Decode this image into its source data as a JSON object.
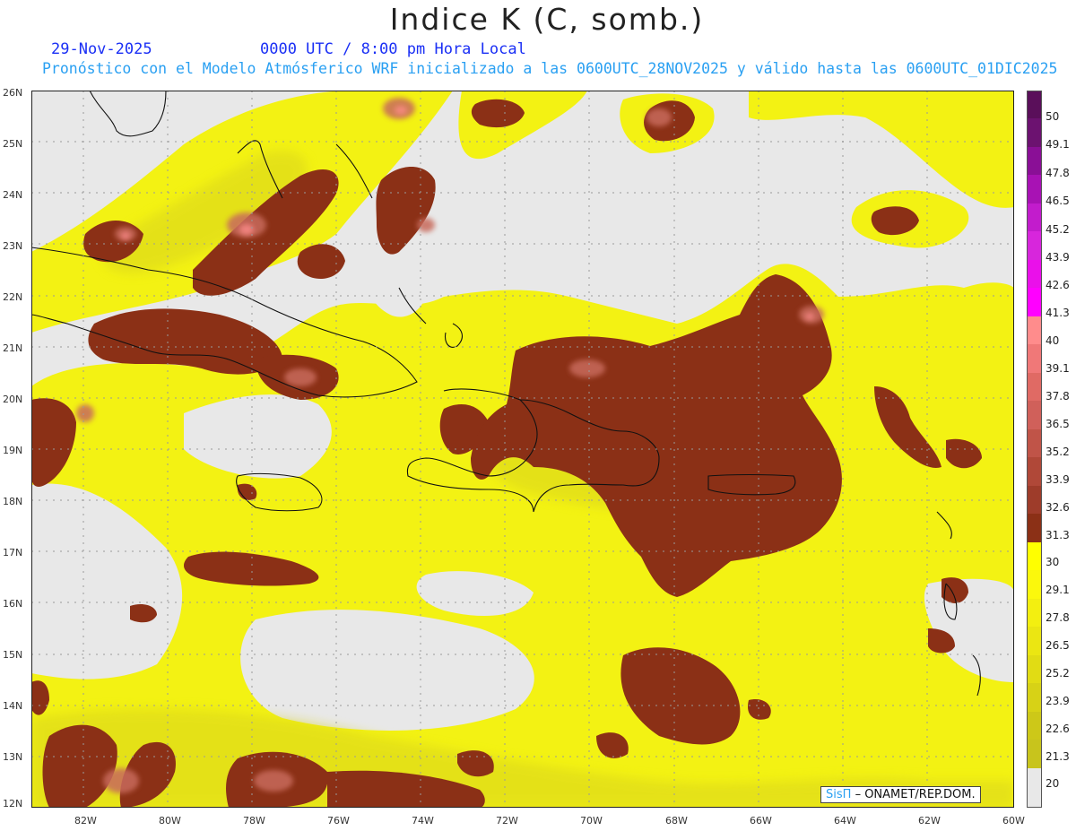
{
  "header": {
    "title": "Indice K (C, somb.)",
    "date": "29-Nov-2025",
    "time": "0000 UTC / 8:00 pm Hora Local",
    "subtitle": "Pronóstico con el Modelo Atmósferico WRF inicializado a las 0600UTC_28NOV2025 y válido hasta las  0600UTC_01DIC2025"
  },
  "axes": {
    "lat_labels": [
      "26N",
      "25N",
      "24N",
      "23N",
      "22N",
      "21N",
      "20N",
      "19N",
      "18N",
      "17N",
      "16N",
      "15N",
      "14N",
      "13N",
      "12N"
    ],
    "lon_labels": [
      "82W",
      "80W",
      "78W",
      "76W",
      "74W",
      "72W",
      "70W",
      "68W",
      "66W",
      "64W",
      "62W",
      "60W"
    ]
  },
  "colorbar": {
    "labels": [
      "50",
      "49.1",
      "47.8",
      "46.5",
      "45.2",
      "43.9",
      "42.6",
      "41.3",
      "40",
      "39.1",
      "37.8",
      "36.5",
      "35.2",
      "33.9",
      "32.6",
      "31.3",
      "30",
      "29.1",
      "27.8",
      "26.5",
      "25.2",
      "23.9",
      "22.6",
      "21.3",
      "20"
    ],
    "colors": {
      "below_20": "#e8e8e8",
      "yellow_light": "#ffff00",
      "yellow_olive": "#c8c41c",
      "brown": "#8b3016",
      "salmon": "#c86a5c",
      "pink": "#ff8c8c",
      "magenta": "#ff00ff",
      "purple": "#5a0f5a"
    }
  },
  "credit": {
    "sis": "SisΠ",
    "rest": "– ONAMET/REP.DOM."
  }
}
